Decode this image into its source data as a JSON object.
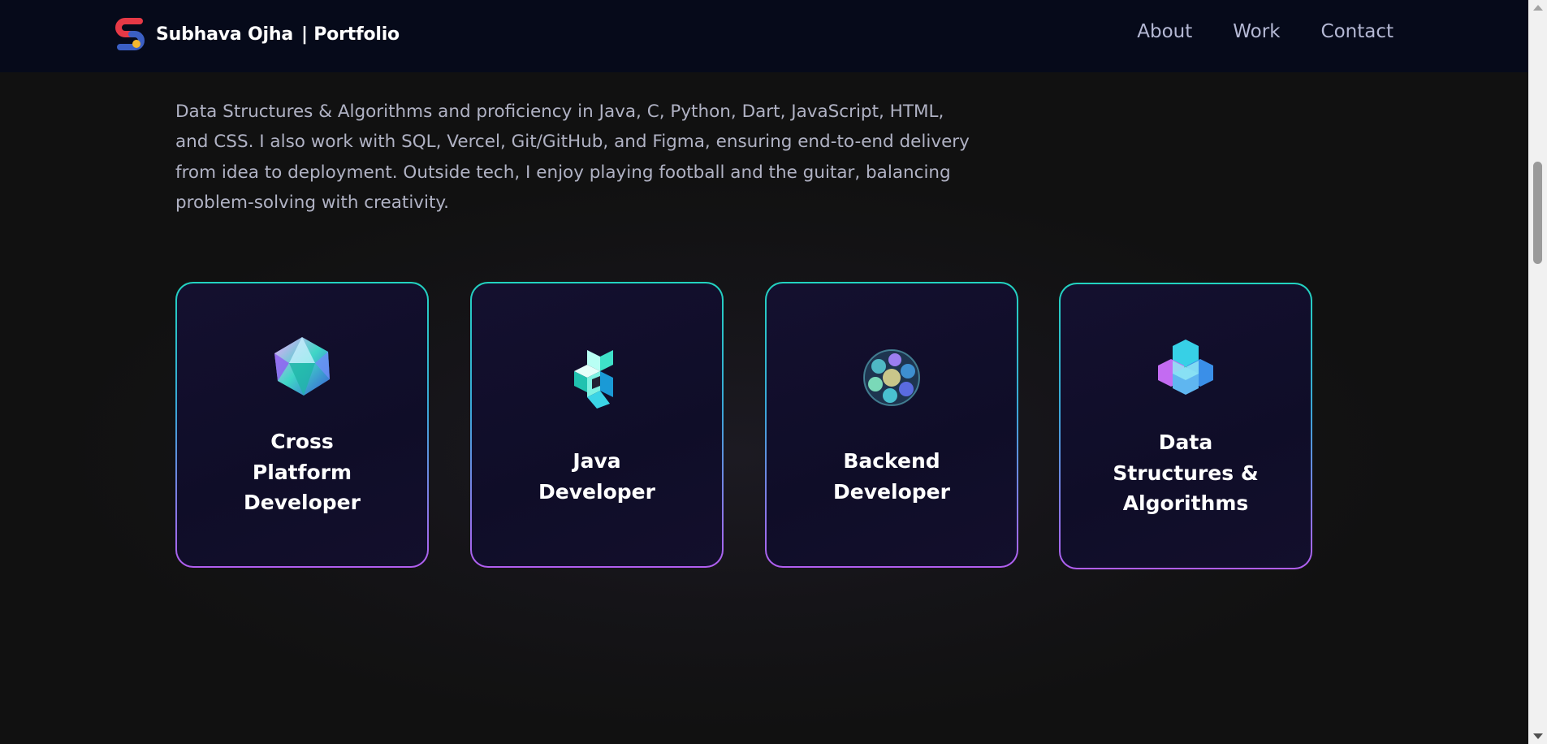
{
  "header": {
    "brand_name": "Subhava Ojha",
    "brand_suffix": "| Portfolio",
    "nav": [
      {
        "label": "About"
      },
      {
        "label": "Work"
      },
      {
        "label": "Contact"
      }
    ]
  },
  "intro": {
    "lines": [
      "Data Structures & Algorithms and proficiency in Java, C, Python, Dart, JavaScript, HTML,",
      "and CSS. I also work with SQL, Vercel, Git/GitHub, and Figma, ensuring end-to-end delivery",
      "from idea to deployment. Outside tech, I enjoy playing football and the guitar, balancing",
      "problem-solving with creativity."
    ]
  },
  "services": [
    {
      "title_lines": [
        "Cross",
        "Platform",
        "Developer"
      ],
      "icon": "icosahedron-icon"
    },
    {
      "title_lines": [
        "Java",
        "Developer"
      ],
      "icon": "cube-knot-icon"
    },
    {
      "title_lines": [
        "Backend",
        "Developer"
      ],
      "icon": "sphere-cluster-icon"
    },
    {
      "title_lines": [
        "Data",
        "Structures &",
        "Algorithms"
      ],
      "icon": "hex-cubes-icon"
    }
  ],
  "colors": {
    "header_bg": "#060a1a",
    "page_bg": "#111111",
    "card_border_top": "#22d3c0",
    "card_border_bottom": "#b25ef0",
    "logo_red": "#e63946",
    "logo_blue": "#3b5fc4",
    "logo_yellow": "#f5b82e"
  }
}
